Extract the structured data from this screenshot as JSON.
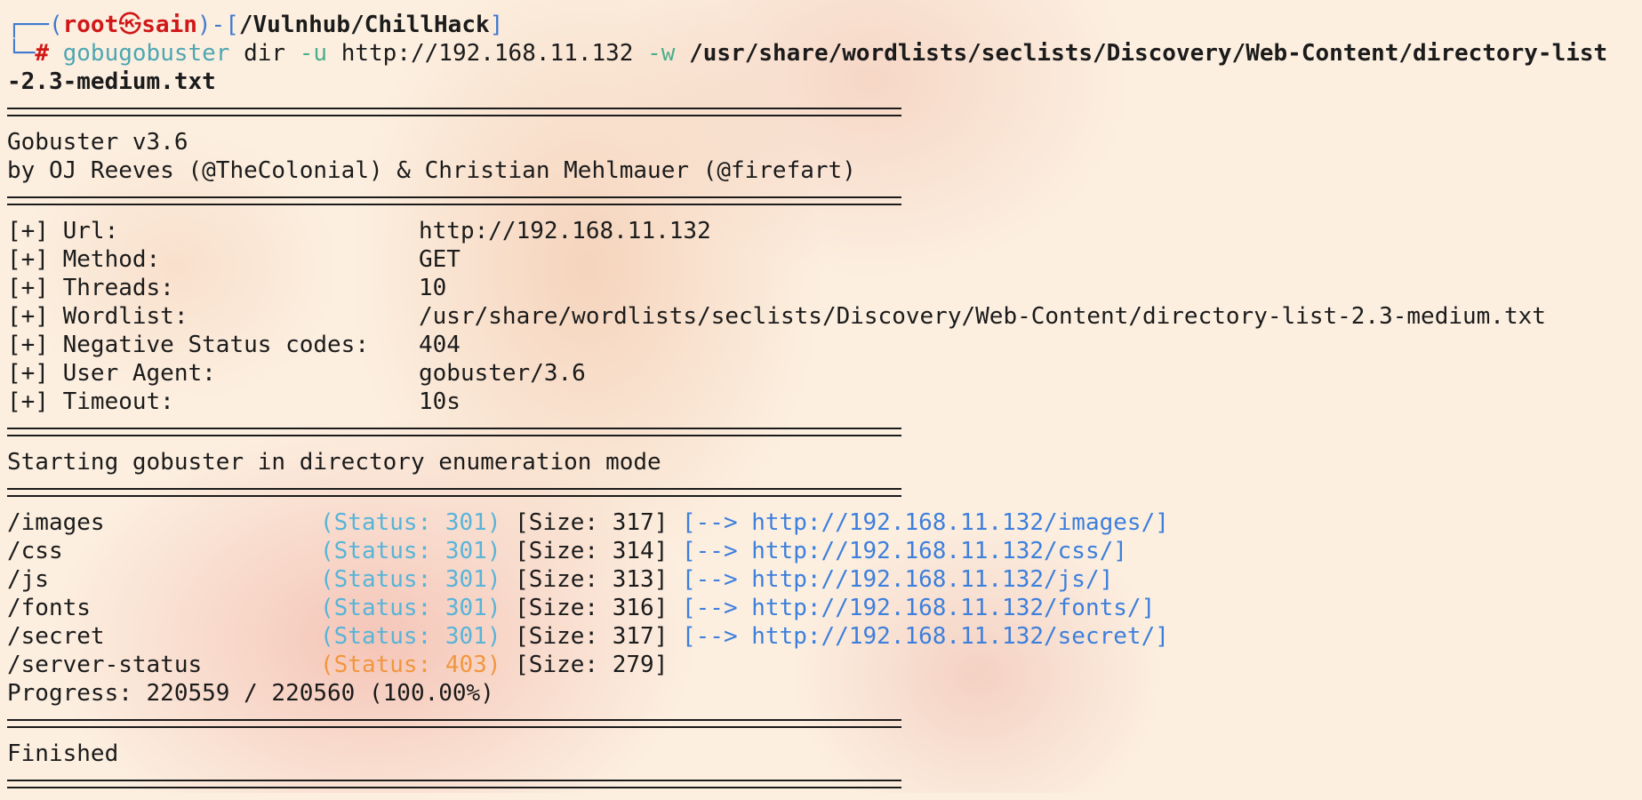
{
  "prompt": {
    "corner_top": "┌──",
    "corner_bottom": "└─",
    "open_paren": "(",
    "user": "root",
    "at_icon": "㉿",
    "host": "sain",
    "close_paren": ")",
    "dash": "-",
    "open_bracket": "[",
    "cwd": "/Vulnhub/ChillHack",
    "close_bracket": "]",
    "hash": "#"
  },
  "command": {
    "binary": "gobugobuster",
    "sub": "dir",
    "flag_u": "-u",
    "url": "http://192.168.11.132",
    "flag_w": "-w",
    "wordlist_line1": "/usr/share/wordlists/seclists/Discovery/Web-Content/directory-list",
    "wordlist_line2": "-2.3-medium.txt"
  },
  "banner": {
    "version": "Gobuster v3.6",
    "authors": "by OJ Reeves (@TheColonial) & Christian Mehlmauer (@firefart)"
  },
  "config": [
    {
      "key": "[+] Url:",
      "value": "http://192.168.11.132"
    },
    {
      "key": "[+] Method:",
      "value": "GET"
    },
    {
      "key": "[+] Threads:",
      "value": "10"
    },
    {
      "key": "[+] Wordlist:",
      "value": "/usr/share/wordlists/seclists/Discovery/Web-Content/directory-list-2.3-medium.txt"
    },
    {
      "key": "[+] Negative Status codes:",
      "value": "404"
    },
    {
      "key": "[+] User Agent:",
      "value": "gobuster/3.6"
    },
    {
      "key": "[+] Timeout:",
      "value": "10s"
    }
  ],
  "start_msg": "Starting gobuster in directory enumeration mode",
  "results": [
    {
      "path": "/images",
      "status": "(Status: 301)",
      "size": "[Size: 317]",
      "arrow": "[-->",
      "redirect": "http://192.168.11.132/images/]"
    },
    {
      "path": "/css",
      "status": "(Status: 301)",
      "size": "[Size: 314]",
      "arrow": "[-->",
      "redirect": "http://192.168.11.132/css/]"
    },
    {
      "path": "/js",
      "status": "(Status: 301)",
      "size": "[Size: 313]",
      "arrow": "[-->",
      "redirect": "http://192.168.11.132/js/]"
    },
    {
      "path": "/fonts",
      "status": "(Status: 301)",
      "size": "[Size: 316]",
      "arrow": "[-->",
      "redirect": "http://192.168.11.132/fonts/]"
    },
    {
      "path": "/secret",
      "status": "(Status: 301)",
      "size": "[Size: 317]",
      "arrow": "[-->",
      "redirect": "http://192.168.11.132/secret/]"
    },
    {
      "path": "/server-status",
      "status": "(Status: 403)",
      "size": "[Size: 279]",
      "arrow": "",
      "redirect": ""
    }
  ],
  "progress": "Progress: 220559 / 220560 (100.00%)",
  "finished": "Finished",
  "colors": {
    "background": "#fcefe0",
    "text": "#1b1b1b",
    "prompt_blue": "#3f7ad0",
    "prompt_red": "#d01818",
    "status_301": "#58b4d8",
    "status_403": "#f2963f",
    "redirect": "#3d7fdc"
  }
}
